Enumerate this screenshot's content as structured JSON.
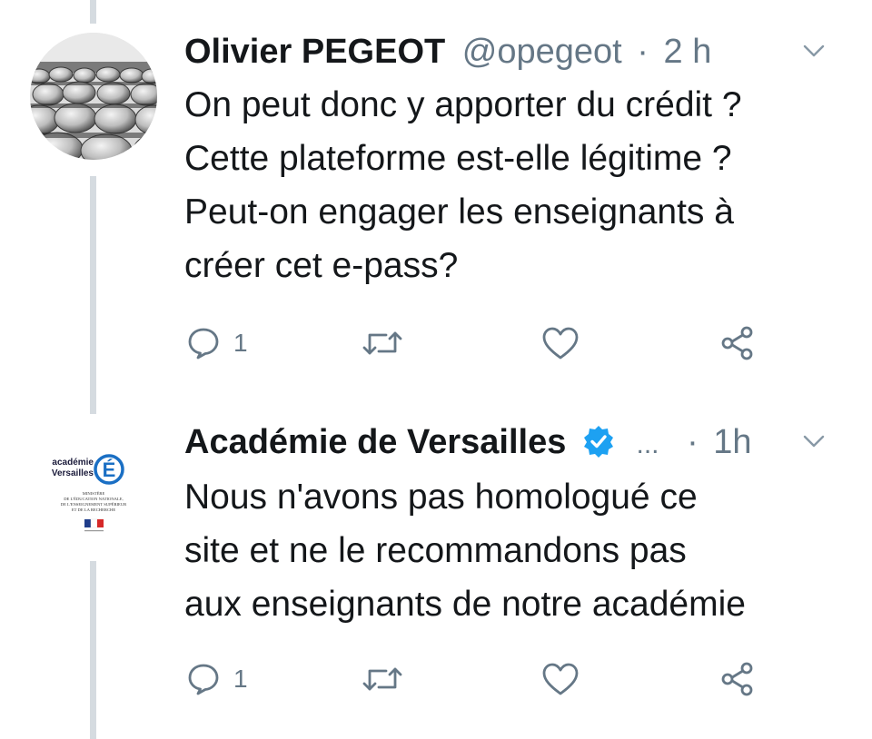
{
  "tweets": [
    {
      "display_name": "Olivier PEGEOT",
      "handle": "@opegeot",
      "separator": "·",
      "time": "2 h",
      "text_lines": [
        "On peut donc y apporter du crédit ?",
        "Cette plateforme est-elle légitime ?",
        "Peut-on engager les enseignants à",
        "créer cet e-pass?"
      ],
      "avatar_icon": "crowd-photo-avatar",
      "actions": {
        "reply_count": "1",
        "retweet_count": "",
        "like_count": ""
      }
    },
    {
      "display_name": "Académie de Versailles",
      "verified": true,
      "ellipsis": "...",
      "separator": "·",
      "time": "1h",
      "text_lines": [
        "Nous n'avons pas homologué ce",
        "site et ne le recommandons pas",
        "aux enseignants de notre académie"
      ],
      "avatar_logo": {
        "line1": "académie",
        "line2": "Versailles",
        "letter": "É",
        "ministry_lines": [
          "MINISTÈRE",
          "DE L'ÉDUCATION NATIONALE,",
          "DE L'ENSEIGNEMENT SUPÉRIEUR",
          "ET DE LA RECHERCHE"
        ]
      },
      "actions": {
        "reply_count": "1",
        "retweet_count": "",
        "like_count": ""
      }
    }
  ],
  "colors": {
    "text": "#14171a",
    "secondary": "#657786",
    "verified_blue": "#1da1f2",
    "thread_line": "#d5dbe0"
  }
}
